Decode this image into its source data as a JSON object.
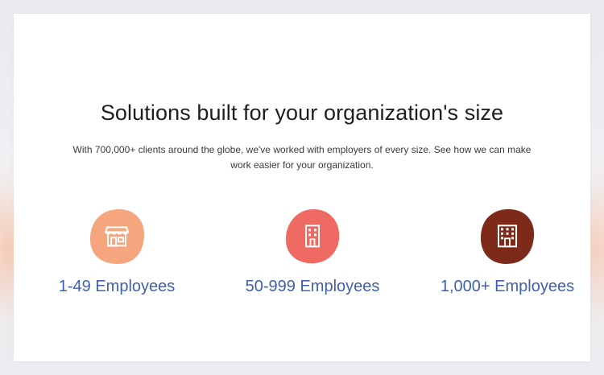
{
  "section": {
    "title": "Solutions built for your organization's size",
    "subtitle": "With 700,000+ clients around the globe, we've worked with employers of every size. See how we can make work easier for your organization."
  },
  "tiles": [
    {
      "label": "1-49 Employees",
      "icon": "storefront-icon",
      "color": "#f5a67e"
    },
    {
      "label": "50-999 Employees",
      "icon": "building-icon",
      "color": "#ee6a62"
    },
    {
      "label": "1,000+ Employees",
      "icon": "office-tower-icon",
      "color": "#7e2a1a"
    }
  ],
  "colors": {
    "link": "#3f5fb0",
    "title": "#1e1e1e",
    "background": "#ffffff"
  }
}
